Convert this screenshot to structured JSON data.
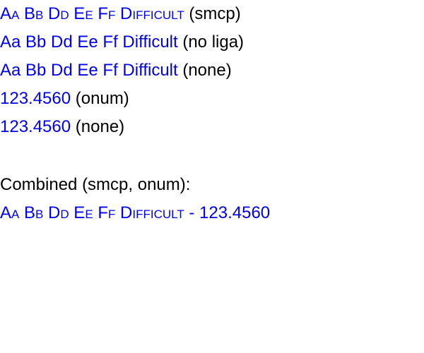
{
  "colors": {
    "sample_text": "#0000ee",
    "label_text": "#000000",
    "background": "#ffffff"
  },
  "lines": [
    {
      "sample": "Aa Bb Dd Ee Ff Difficult",
      "label": "(smcp)"
    },
    {
      "sample": "Aa Bb Dd Ee Ff Difficult",
      "label": "(no liga)"
    },
    {
      "sample": "Aa Bb Dd Ee Ff Difficult",
      "label": "(none)"
    },
    {
      "sample": "123.4560",
      "label": "(onum)"
    },
    {
      "sample": "123.4560",
      "label": "(none)"
    }
  ],
  "combined": {
    "heading": "Combined (smcp, onum):",
    "sample": "Aa Bb Dd Ee Ff Difficult - 123.4560"
  }
}
